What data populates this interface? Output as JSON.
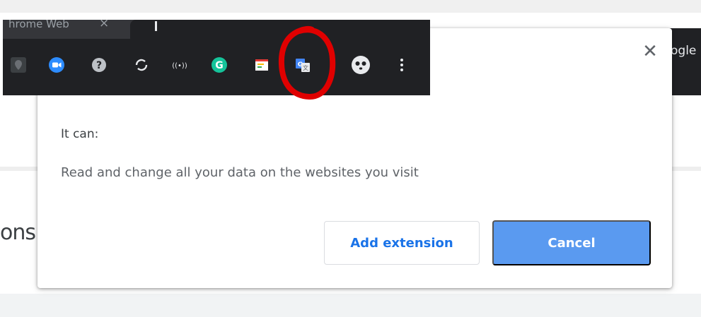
{
  "background": {
    "right_header_text": "ogle",
    "left_partial_heading": "ons"
  },
  "browser": {
    "inactive_tab": {
      "title": "hrome Web",
      "close_glyph": "×"
    },
    "extension_icons": [
      "location-pin-icon",
      "zoom-video-icon",
      "help-circle-icon",
      "sync-icon",
      "wireless-signal-icon",
      "grammarly-icon",
      "notes-icon",
      "google-translate-icon",
      "panda-face-icon"
    ],
    "menu_icon": "vertical-dots-icon",
    "highlight_color": "#e00000"
  },
  "dialog": {
    "close_glyph": "✕",
    "it_can_label": "It can:",
    "permission": "Read and change all your data on the websites you visit",
    "add_button_label": "Add extension",
    "cancel_button_label": "Cancel"
  },
  "colors": {
    "accent": "#1a73e8",
    "cancel_bg": "#5a9af0",
    "toolbar_bg": "#202124"
  }
}
